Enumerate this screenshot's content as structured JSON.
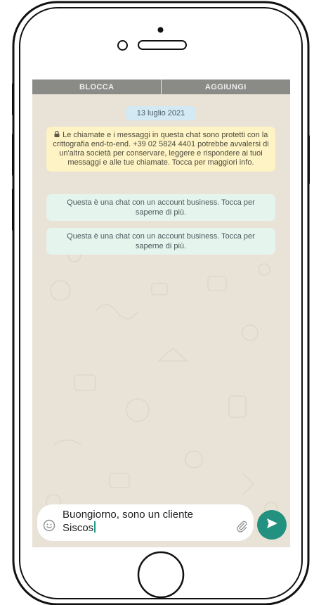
{
  "colors": {
    "topbar_bg": "#8a8a87",
    "chat_bg": "#e9e2d6",
    "date_chip_bg": "#d3eaf5",
    "encryption_note_bg": "#fdf3c4",
    "business_note_bg": "#e6f4ee",
    "send_button_bg": "#22917f",
    "caret": "#1f9a86"
  },
  "topbar": {
    "block_label": "BLOCCA",
    "add_label": "AGGIUNGI"
  },
  "chat": {
    "date_label": "13 luglio 2021",
    "encryption_icon": "lock-icon",
    "encryption_text": "Le chiamate e i messaggi in questa chat sono protetti con la crittografia end-to-end. +39 02 5824 4401 potrebbe avvalersi di un'altra società per conservare, leggere e rispondere ai tuoi messaggi e alle tue chiamate. Tocca per maggiori info.",
    "business_notes": [
      "Questa è una chat con un account business. Tocca per saperne di più.",
      "Questa è una chat con un account business. Tocca per saperne di più."
    ]
  },
  "composer": {
    "value": "Buongiorno, sono un cliente\nSiscos",
    "emoji_icon": "smiley-icon",
    "attach_icon": "paperclip-icon",
    "send_icon": "send-arrow-icon"
  }
}
